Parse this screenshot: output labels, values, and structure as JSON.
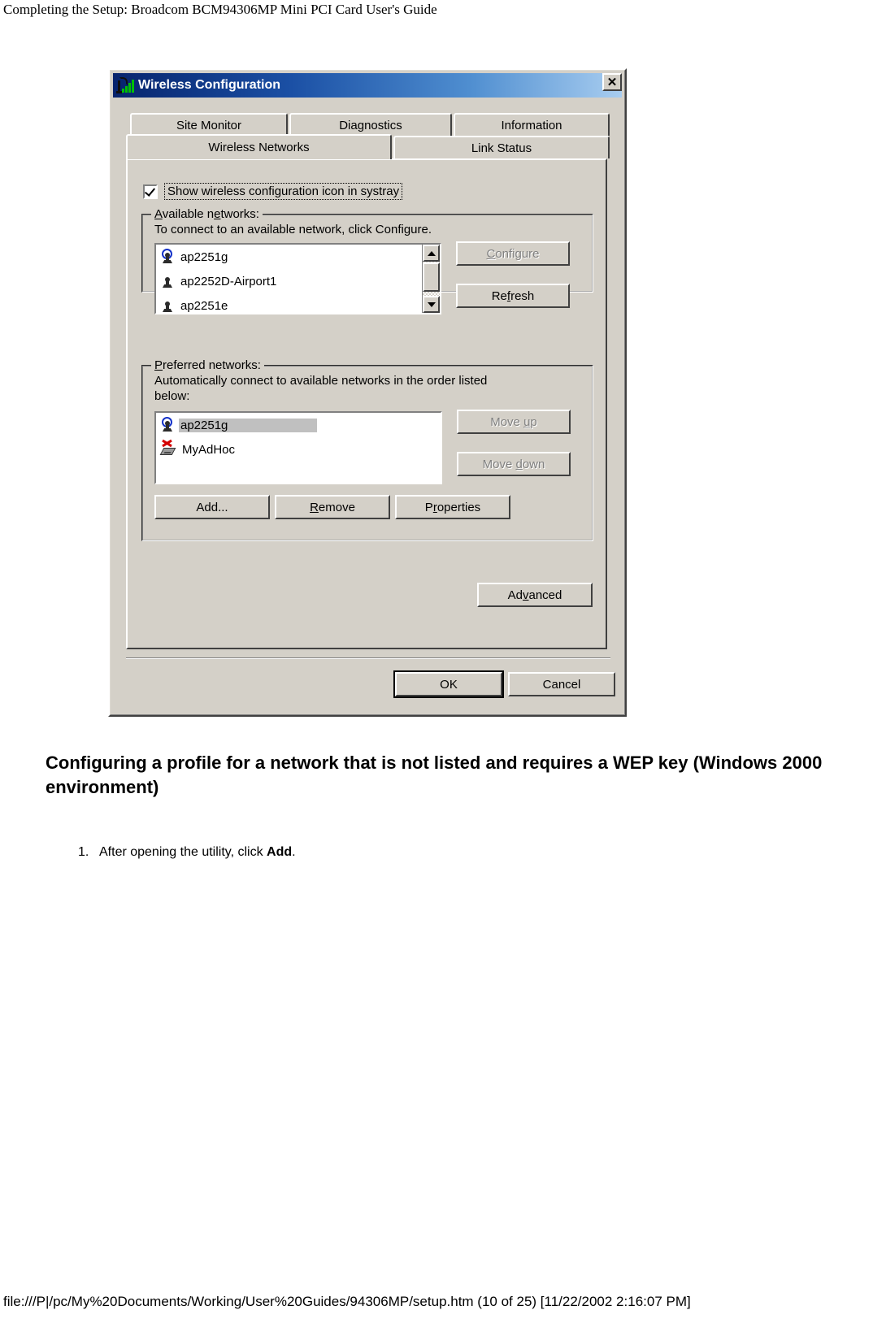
{
  "page": {
    "header": "Completing the Setup: Broadcom BCM94306MP Mini PCI Card User's Guide",
    "footer": "file:///P|/pc/My%20Documents/Working/User%20Guides/94306MP/setup.htm (10 of 25) [11/22/2002 2:16:07 PM]",
    "heading": "Configuring a profile for a network that is not listed and requires a WEP key (Windows 2000 environment)",
    "steps": [
      {
        "number": "1.",
        "text_before": "After opening the utility, click ",
        "bold": "Add",
        "text_after": "."
      }
    ]
  },
  "dialog": {
    "title": "Wireless Configuration",
    "title_icon": "signal-bars-icon",
    "close_label": "✕",
    "titlebar_gradient_start": "#07246d",
    "titlebar_gradient_end": "#a8cdf0",
    "face_color": "#d4d0c8",
    "tabs_row1": [
      {
        "label": "Site Monitor",
        "active": false
      },
      {
        "label": "Diagnostics",
        "active": false
      },
      {
        "label": "Information",
        "active": false
      }
    ],
    "tabs_row2": [
      {
        "label": "Wireless Networks",
        "active": true
      },
      {
        "label": "Link Status",
        "active": false
      }
    ],
    "systray_checkbox": {
      "label": "Show wireless configuration icon in systray",
      "checked": true
    },
    "available_networks": {
      "legend": "Available networks:",
      "note": "To connect to an available network, click Configure.",
      "items": [
        {
          "name": "ap2251g",
          "icon": "access-point-active-icon"
        },
        {
          "name": "ap2252D-Airport1",
          "icon": "access-point-icon"
        },
        {
          "name": "ap2251e",
          "icon": "access-point-icon"
        }
      ],
      "buttons": [
        {
          "label": "Configure",
          "accel": "C",
          "disabled": true
        },
        {
          "label": "Refresh",
          "accel": "f",
          "disabled": false
        }
      ]
    },
    "preferred_networks": {
      "legend": "Preferred networks:",
      "note_line1": "Automatically connect to available networks in the order listed",
      "note_line2": "below:",
      "items": [
        {
          "name": "ap2251g",
          "icon": "access-point-active-icon",
          "selected": true
        },
        {
          "name": "MyAdHoc",
          "icon": "adhoc-network-icon",
          "selected": false
        }
      ],
      "side_buttons": [
        {
          "label": "Move up",
          "accel": "u",
          "disabled": true
        },
        {
          "label": "Move down",
          "accel": "d",
          "disabled": true
        }
      ],
      "bottom_buttons": [
        {
          "label": "Add...",
          "accel": "",
          "disabled": false
        },
        {
          "label": "Remove",
          "accel": "R",
          "disabled": false
        },
        {
          "label": "Properties",
          "accel": "P",
          "disabled": false
        }
      ]
    },
    "advanced_button": {
      "label": "Advanced",
      "accel": "v",
      "disabled": false
    },
    "footer_buttons": [
      {
        "label": "OK",
        "default": true
      },
      {
        "label": "Cancel",
        "default": false
      }
    ]
  }
}
